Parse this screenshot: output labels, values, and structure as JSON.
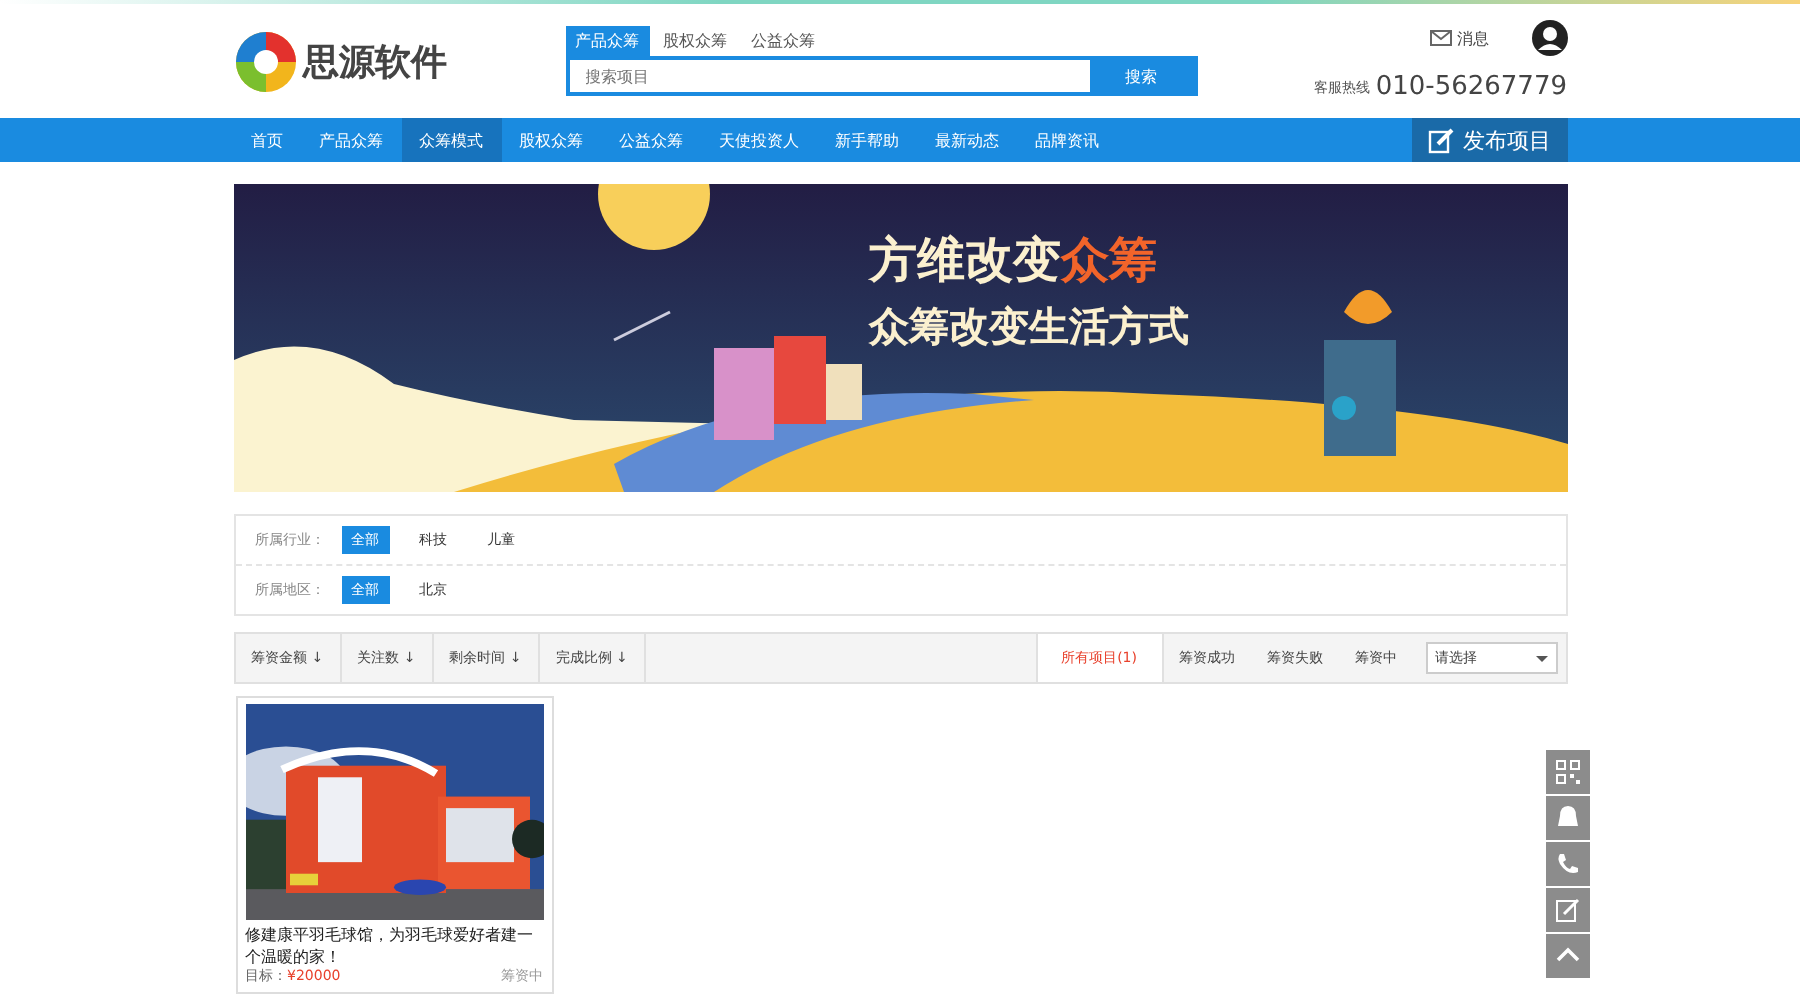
{
  "header": {
    "logo": "思源软件",
    "search_tabs": [
      {
        "label": "产品众筹",
        "selected": true
      },
      {
        "label": "股权众筹",
        "selected": false
      },
      {
        "label": "公益众筹",
        "selected": false
      }
    ],
    "search": {
      "placeholder": "搜索项目",
      "button": "搜索"
    },
    "messages": "消息",
    "hotline_label": "客服热线",
    "hotline": "010-56267779"
  },
  "nav": {
    "items": [
      {
        "label": "首页",
        "selected": false
      },
      {
        "label": "产品众筹",
        "selected": false
      },
      {
        "label": "众筹模式",
        "selected": true
      },
      {
        "label": "股权众筹",
        "selected": false
      },
      {
        "label": "公益众筹",
        "selected": false
      },
      {
        "label": "天使投资人",
        "selected": false
      },
      {
        "label": "新手帮助",
        "selected": false
      },
      {
        "label": "最新动态",
        "selected": false
      },
      {
        "label": "品牌资讯",
        "selected": false
      }
    ],
    "publish": "发布项目"
  },
  "banner": {
    "kind": "picture",
    "title_plain": "方维改变",
    "title_accent": "众筹",
    "subtitle": "众筹改变生活方式"
  },
  "filters": [
    {
      "label": "所属行业：",
      "options": [
        {
          "label": "全部",
          "selected": true
        },
        {
          "label": "科技",
          "selected": false
        },
        {
          "label": "儿童",
          "selected": false
        }
      ]
    },
    {
      "label": "所属地区：",
      "options": [
        {
          "label": "全部",
          "selected": true
        },
        {
          "label": "北京",
          "selected": false
        }
      ]
    }
  ],
  "sort": {
    "columns": [
      "筹资金额 ↓",
      "关注数 ↓",
      "剩余时间 ↓",
      "完成比例 ↓"
    ],
    "statuses": [
      {
        "label": "所有项目(1)",
        "selected": true
      },
      {
        "label": "筹资成功",
        "selected": false
      },
      {
        "label": "筹资失败",
        "selected": false
      },
      {
        "label": "筹资中",
        "selected": false
      }
    ],
    "select": "请选择"
  },
  "projects": [
    {
      "kind": "picture",
      "title": "修建康平羽毛球馆，为羽毛球爱好者建一个温暖的家！",
      "goal_label": "目标：",
      "goal": "¥20000",
      "status": "筹资中"
    }
  ]
}
